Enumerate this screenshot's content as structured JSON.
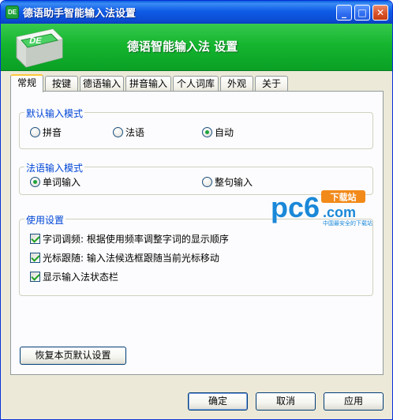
{
  "window": {
    "title": "德语助手智能输入法设置",
    "icon_text": "DE"
  },
  "titlebar": {
    "min_label": "_",
    "max_label": "□",
    "close_label": "✕"
  },
  "banner": {
    "title": "德语智能输入法 设置",
    "logo_text": "DE"
  },
  "tabs": [
    {
      "label": "常规",
      "active": true
    },
    {
      "label": "按键",
      "active": false
    },
    {
      "label": "德语输入",
      "active": false
    },
    {
      "label": "拼音输入",
      "active": false
    },
    {
      "label": "个人词库",
      "active": false
    },
    {
      "label": "外观",
      "active": false
    },
    {
      "label": "关于",
      "active": false
    }
  ],
  "default_mode": {
    "title": "默认输入模式",
    "options": [
      {
        "label": "拼音",
        "selected": false
      },
      {
        "label": "法语",
        "selected": false
      },
      {
        "label": "自动",
        "selected": true
      }
    ]
  },
  "french_mode": {
    "title": "法语输入模式",
    "options": [
      {
        "label": "单词输入",
        "selected": true
      },
      {
        "label": "整句输入",
        "selected": false
      }
    ]
  },
  "usage": {
    "title": "使用设置",
    "checks": [
      {
        "label": "字词调频: 根据使用频率调整字词的显示顺序",
        "checked": true
      },
      {
        "label": "光标跟随: 输入法候选框跟随当前光标移动",
        "checked": true
      },
      {
        "label": "显示输入法状态栏",
        "checked": true
      }
    ]
  },
  "watermark": {
    "brand": "pc6",
    "domain": ".com",
    "badge": "下载站",
    "slogan": "中国最安全的下载站"
  },
  "buttons": {
    "restore": "恢复本页默认设置",
    "ok": "确定",
    "cancel": "取消",
    "apply": "应用"
  },
  "colors": {
    "banner_green": "#15b52f",
    "titlebar_blue": "#0b4fd6",
    "group_title": "#0046d5",
    "watermark_blue": "#1a88d8",
    "watermark_orange": "#f28a1a"
  }
}
